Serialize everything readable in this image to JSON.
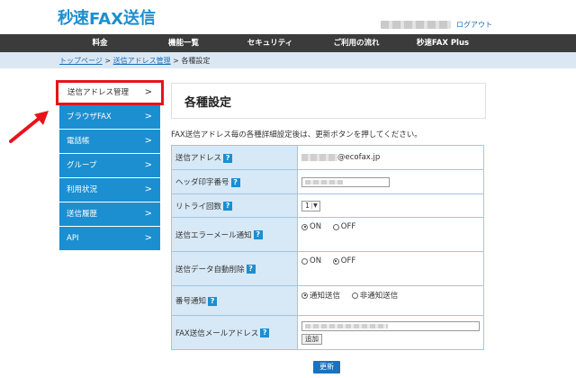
{
  "header": {
    "logo_fax_prefix": "秒速",
    "logo_fax": "FAX",
    "logo_suffix": "送信",
    "logout": "ログアウト"
  },
  "nav": [
    "料金",
    "機能一覧",
    "セキュリティ",
    "ご利用の流れ",
    "秒速FAX Plus"
  ],
  "breadcrumb": {
    "top": "トップページ",
    "sep1": " > ",
    "mid": "送信アドレス管理",
    "sep2": " > ",
    "current": "各種設定"
  },
  "sidebar": [
    {
      "label": "送信アドレス管理",
      "active": true
    },
    {
      "label": "ブラウザFAX"
    },
    {
      "label": "電話帳"
    },
    {
      "label": "グループ"
    },
    {
      "label": "利用状況"
    },
    {
      "label": "送信履歴"
    },
    {
      "label": "API"
    }
  ],
  "main": {
    "title": "各種設定",
    "intro": "FAX送信アドレス毎の各種詳細設定後は、更新ボタンを押してください。",
    "help_mark": "?",
    "chevron": ">",
    "rows": {
      "address": {
        "label": "送信アドレス",
        "value": "@ecofax.jp"
      },
      "header": {
        "label": "ヘッダ印字番号"
      },
      "retry": {
        "label": "リトライ回数",
        "value": "1"
      },
      "error_mail": {
        "label": "送信エラーメール通知",
        "on": "ON",
        "off": "OFF",
        "selected": "ON"
      },
      "auto_delete": {
        "label": "送信データ自動削除",
        "on": "ON",
        "off": "OFF",
        "selected": "OFF"
      },
      "number_notice": {
        "label": "番号通知",
        "opt1": "通知送信",
        "opt2": "非通知送信",
        "selected": "通知送信"
      },
      "fax_mail": {
        "label": "FAX送信メールアドレス",
        "add_button": "追加"
      }
    },
    "submit": "更新"
  },
  "colors": {
    "brand_blue": "#1b8fd0",
    "nav_dark": "#3b3b3b",
    "highlight_red": "#e8131b",
    "table_header_bg": "#d7e8f6",
    "breadcrumb_bg": "#dbe8f4"
  }
}
